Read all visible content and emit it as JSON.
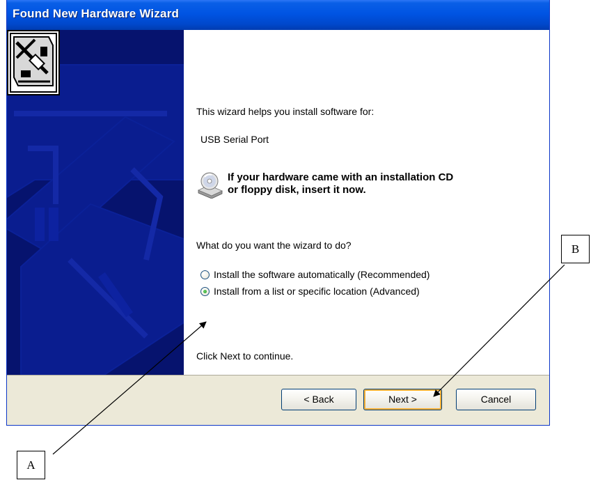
{
  "window": {
    "title": "Found New Hardware Wizard"
  },
  "content": {
    "intro": "This wizard helps you install software for:",
    "device_name": "USB Serial Port",
    "notice_line1": "If your hardware came with an installation CD",
    "notice_line2": "or floppy disk, insert it now.",
    "question": "What do you want the wizard to do?",
    "options": [
      {
        "label": "Install the software automatically (Recommended)",
        "selected": false
      },
      {
        "label": "Install from a list or specific location (Advanced)",
        "selected": true
      }
    ],
    "footer_hint": "Click Next to continue."
  },
  "buttons": {
    "back": "< Back",
    "next": "Next >",
    "cancel": "Cancel"
  },
  "annotations": {
    "a_label": "A",
    "b_label": "B"
  },
  "icons": {
    "hardware": "hardware-board-icon",
    "cd": "cd-drive-icon"
  },
  "colors": {
    "title_bar": "#0054e3",
    "side_panel": "#06136e",
    "dialog_bg": "#ece9d8",
    "default_button_highlight": "#f8b237"
  }
}
